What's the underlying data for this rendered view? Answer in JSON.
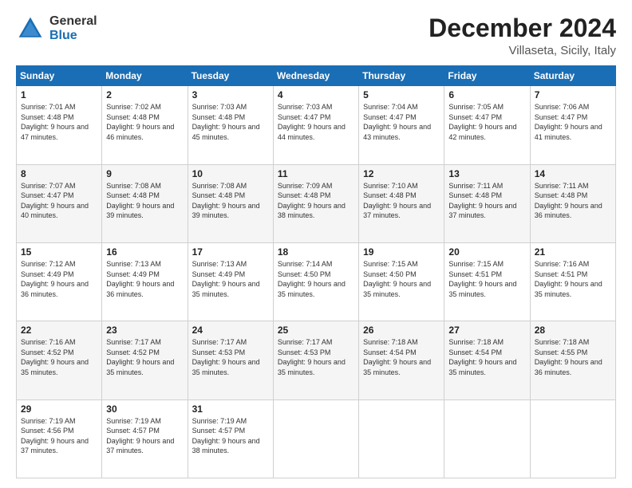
{
  "logo": {
    "general": "General",
    "blue": "Blue"
  },
  "header": {
    "month": "December 2024",
    "location": "Villaseta, Sicily, Italy"
  },
  "days_of_week": [
    "Sunday",
    "Monday",
    "Tuesday",
    "Wednesday",
    "Thursday",
    "Friday",
    "Saturday"
  ],
  "weeks": [
    [
      {
        "day": "1",
        "sunrise": "7:01 AM",
        "sunset": "4:48 PM",
        "daylight": "9 hours and 47 minutes."
      },
      {
        "day": "2",
        "sunrise": "7:02 AM",
        "sunset": "4:48 PM",
        "daylight": "9 hours and 46 minutes."
      },
      {
        "day": "3",
        "sunrise": "7:03 AM",
        "sunset": "4:48 PM",
        "daylight": "9 hours and 45 minutes."
      },
      {
        "day": "4",
        "sunrise": "7:03 AM",
        "sunset": "4:47 PM",
        "daylight": "9 hours and 44 minutes."
      },
      {
        "day": "5",
        "sunrise": "7:04 AM",
        "sunset": "4:47 PM",
        "daylight": "9 hours and 43 minutes."
      },
      {
        "day": "6",
        "sunrise": "7:05 AM",
        "sunset": "4:47 PM",
        "daylight": "9 hours and 42 minutes."
      },
      {
        "day": "7",
        "sunrise": "7:06 AM",
        "sunset": "4:47 PM",
        "daylight": "9 hours and 41 minutes."
      }
    ],
    [
      {
        "day": "8",
        "sunrise": "7:07 AM",
        "sunset": "4:47 PM",
        "daylight": "9 hours and 40 minutes."
      },
      {
        "day": "9",
        "sunrise": "7:08 AM",
        "sunset": "4:48 PM",
        "daylight": "9 hours and 39 minutes."
      },
      {
        "day": "10",
        "sunrise": "7:08 AM",
        "sunset": "4:48 PM",
        "daylight": "9 hours and 39 minutes."
      },
      {
        "day": "11",
        "sunrise": "7:09 AM",
        "sunset": "4:48 PM",
        "daylight": "9 hours and 38 minutes."
      },
      {
        "day": "12",
        "sunrise": "7:10 AM",
        "sunset": "4:48 PM",
        "daylight": "9 hours and 37 minutes."
      },
      {
        "day": "13",
        "sunrise": "7:11 AM",
        "sunset": "4:48 PM",
        "daylight": "9 hours and 37 minutes."
      },
      {
        "day": "14",
        "sunrise": "7:11 AM",
        "sunset": "4:48 PM",
        "daylight": "9 hours and 36 minutes."
      }
    ],
    [
      {
        "day": "15",
        "sunrise": "7:12 AM",
        "sunset": "4:49 PM",
        "daylight": "9 hours and 36 minutes."
      },
      {
        "day": "16",
        "sunrise": "7:13 AM",
        "sunset": "4:49 PM",
        "daylight": "9 hours and 36 minutes."
      },
      {
        "day": "17",
        "sunrise": "7:13 AM",
        "sunset": "4:49 PM",
        "daylight": "9 hours and 35 minutes."
      },
      {
        "day": "18",
        "sunrise": "7:14 AM",
        "sunset": "4:50 PM",
        "daylight": "9 hours and 35 minutes."
      },
      {
        "day": "19",
        "sunrise": "7:15 AM",
        "sunset": "4:50 PM",
        "daylight": "9 hours and 35 minutes."
      },
      {
        "day": "20",
        "sunrise": "7:15 AM",
        "sunset": "4:51 PM",
        "daylight": "9 hours and 35 minutes."
      },
      {
        "day": "21",
        "sunrise": "7:16 AM",
        "sunset": "4:51 PM",
        "daylight": "9 hours and 35 minutes."
      }
    ],
    [
      {
        "day": "22",
        "sunrise": "7:16 AM",
        "sunset": "4:52 PM",
        "daylight": "9 hours and 35 minutes."
      },
      {
        "day": "23",
        "sunrise": "7:17 AM",
        "sunset": "4:52 PM",
        "daylight": "9 hours and 35 minutes."
      },
      {
        "day": "24",
        "sunrise": "7:17 AM",
        "sunset": "4:53 PM",
        "daylight": "9 hours and 35 minutes."
      },
      {
        "day": "25",
        "sunrise": "7:17 AM",
        "sunset": "4:53 PM",
        "daylight": "9 hours and 35 minutes."
      },
      {
        "day": "26",
        "sunrise": "7:18 AM",
        "sunset": "4:54 PM",
        "daylight": "9 hours and 35 minutes."
      },
      {
        "day": "27",
        "sunrise": "7:18 AM",
        "sunset": "4:54 PM",
        "daylight": "9 hours and 35 minutes."
      },
      {
        "day": "28",
        "sunrise": "7:18 AM",
        "sunset": "4:55 PM",
        "daylight": "9 hours and 36 minutes."
      }
    ],
    [
      {
        "day": "29",
        "sunrise": "7:19 AM",
        "sunset": "4:56 PM",
        "daylight": "9 hours and 37 minutes."
      },
      {
        "day": "30",
        "sunrise": "7:19 AM",
        "sunset": "4:57 PM",
        "daylight": "9 hours and 37 minutes."
      },
      {
        "day": "31",
        "sunrise": "7:19 AM",
        "sunset": "4:57 PM",
        "daylight": "9 hours and 38 minutes."
      },
      null,
      null,
      null,
      null
    ]
  ]
}
